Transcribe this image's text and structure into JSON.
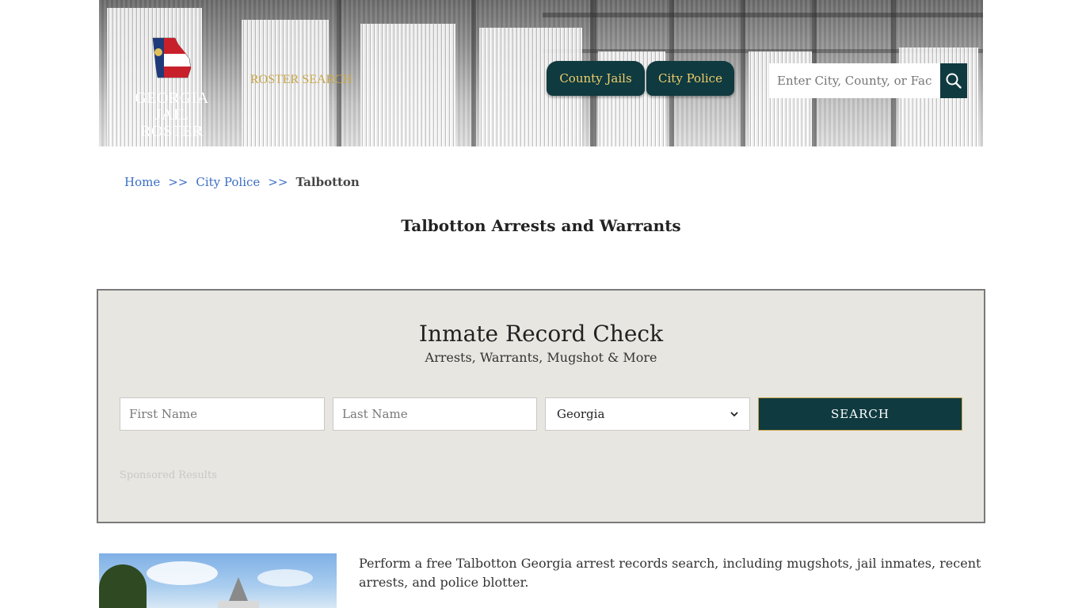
{
  "header": {
    "logo_line1": "GEORGIA",
    "logo_line2": "JAIL ROSTER",
    "roster_link": "ROSTER SEARCH",
    "nav": [
      {
        "label": "County Jails"
      },
      {
        "label": "City Police"
      }
    ],
    "search_placeholder": "Enter City, County, or Facility"
  },
  "breadcrumb": {
    "home": "Home",
    "sep": ">>",
    "section": "City Police",
    "current": "Talbotton"
  },
  "page_title": "Talbotton Arrests and Warrants",
  "record_check": {
    "title": "Inmate Record Check",
    "subtitle": "Arrests, Warrants, Mugshot & More",
    "first_name_placeholder": "First Name",
    "last_name_placeholder": "Last Name",
    "state_selected": "Georgia",
    "search_label": "SEARCH",
    "sponsored": "Sponsored Results"
  },
  "intro_text": "Perform a free Talbotton Georgia arrest records search, including mugshots, jail inmates, recent arrests, and police blotter.",
  "colors": {
    "brand_dark": "#0f3a40",
    "accent_gold": "#c9a84a",
    "link_blue": "#3b6fc4",
    "panel_bg": "#e8e6e0"
  }
}
